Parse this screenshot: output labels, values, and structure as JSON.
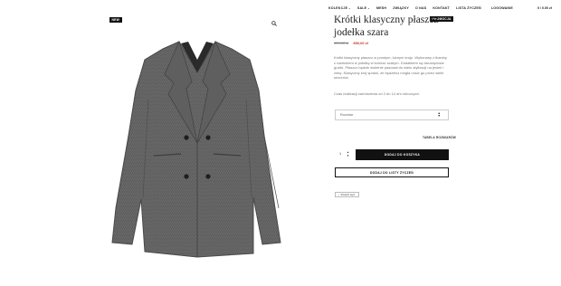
{
  "nav": {
    "items": [
      {
        "label": "KOLEKCJE",
        "caret": "⌄"
      },
      {
        "label": "SALE",
        "caret": "⌄"
      },
      {
        "label": "MESH",
        "caret": ""
      },
      {
        "label": "ZWIĄZKY",
        "caret": ""
      },
      {
        "label": "O NAS",
        "caret": ""
      },
      {
        "label": "KONTAKT",
        "caret": ""
      },
      {
        "label": "LISTA ŻYCZEŃ",
        "caret": ""
      },
      {
        "label": "LOGOWANIE",
        "caret": ""
      }
    ],
    "cart": "0 / 0.00 zł"
  },
  "badges": {
    "new": "NEW",
    "promo": "PROMOCJA"
  },
  "icons": {
    "zoom": "search-icon",
    "back": "chevron-left-icon"
  },
  "product": {
    "title": "Krótki klasyczny płaszcz jodełka szara",
    "old_price": "929,00 zł",
    "new_price": "890,00 zł",
    "description": "Krótki klasyczny płaszcz w prostym, luźnym kroju. Wykonany z tkaniny z nadrukiem w jodełkę w kolorze szarym. Dodatkiem są dwurzędowe guziki. Płaszcz będzie świetnie pasował do wielu stylizacji na jesień i zimę. Klasyczny krój sprawi, że będziesz mogła nosić go przez wiele sezonów.",
    "lead_time": "Czas realizacji zamówienia od 2 do 14 dni roboczych."
  },
  "size_select": {
    "placeholder": "Rozmiar"
  },
  "size_table_link": "TABELA ROZMIARÓW",
  "quantity": "1",
  "add_to_cart": "DODAJ DO KOSZYKA",
  "add_to_wishlist": "DODAJ DO LISTY ŻYCZEŃ",
  "back_label": "Powrót wyż."
}
